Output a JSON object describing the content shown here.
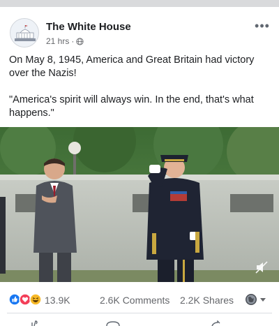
{
  "post": {
    "author": "The White House",
    "time": "21 hrs",
    "time_separator": "·",
    "privacy_icon": "globe-icon",
    "more_icon": "more-options-icon",
    "more_glyph": "•••",
    "text_paragraph_1": "On May 8, 1945, America and Great Britain had victory over the Nazis!",
    "text_paragraph_2": "\"America's spirit will always win. In the end, that's what happens.\""
  },
  "engagement": {
    "reaction_icons": [
      "like-icon",
      "love-icon",
      "haha-icon"
    ],
    "reaction_count": "13.9K",
    "comments": "2.6K Comments",
    "shares": "2.2K Shares"
  },
  "colors": {
    "like": "#1877f2",
    "love": "#f33e58",
    "haha": "#f7b928",
    "meta_text": "#65676b",
    "divider": "#dadde1"
  },
  "actions": {
    "icons": [
      "like-action-icon",
      "comment-action-icon",
      "share-action-icon"
    ]
  }
}
